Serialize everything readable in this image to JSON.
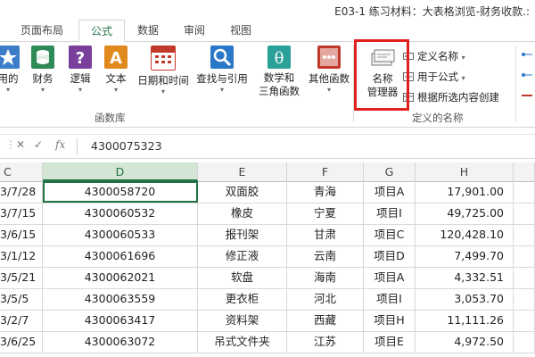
{
  "window": {
    "title": "E03-1 练习材料：大表格浏览-财务收款.:"
  },
  "tabs": [
    {
      "label": "页面布局"
    },
    {
      "label": "公式"
    },
    {
      "label": "数据"
    },
    {
      "label": "审阅"
    },
    {
      "label": "视图"
    }
  ],
  "ribbon": {
    "function_buttons": [
      {
        "label": "用的",
        "icon": "star-icon",
        "color": "#3b7dc8"
      },
      {
        "label": "财务",
        "icon": "coins-icon",
        "color": "#2e8b57"
      },
      {
        "label": "逻辑",
        "icon": "question-icon",
        "color": "#7a3e9d"
      },
      {
        "label": "文本",
        "icon": "text-a-icon",
        "color": "#e08a1e"
      },
      {
        "label": "日期和时间",
        "icon": "calendar-icon",
        "color": "#c0392b"
      },
      {
        "label": "查找与引用",
        "icon": "search-ref-icon",
        "color": "#2a78c8"
      },
      {
        "label_line1": "数学和",
        "label_line2": "三角函数",
        "icon": "theta-icon",
        "color": "#2aa198"
      },
      {
        "label": "其他函数",
        "icon": "more-functions-icon",
        "color": "#c0392b"
      }
    ],
    "function_group_label": "函数库",
    "name_manager": {
      "line1": "名称",
      "line2": "管理器",
      "icon": "name-manager-icon"
    },
    "define_name": {
      "label": "定义名称",
      "icon": "tag-icon"
    },
    "use_in_formula": {
      "label": "用于公式",
      "icon": "formula-icon"
    },
    "create_from_selection": {
      "label": "根据所选内容创建",
      "icon": "grid-create-icon"
    },
    "defined_names_group_label": "定义的名称"
  },
  "formula_bar": {
    "cancel_symbol": "✕",
    "enter_symbol": "✓",
    "fx_label": "fx",
    "value": "4300075323"
  },
  "column_headers": [
    "C",
    "D",
    "E",
    "F",
    "G",
    "H"
  ],
  "rows": [
    {
      "c": "3/7/28",
      "d": "4300058720",
      "e": "双面胶",
      "f": "青海",
      "g": "项目A",
      "h": "17,901.00"
    },
    {
      "c": "3/7/15",
      "d": "4300060532",
      "e": "橡皮",
      "f": "宁夏",
      "g": "项目I",
      "h": "49,725.00"
    },
    {
      "c": "3/6/15",
      "d": "4300060533",
      "e": "报刊架",
      "f": "甘肃",
      "g": "项目C",
      "h": "120,428.10"
    },
    {
      "c": "3/1/12",
      "d": "4300061696",
      "e": "修正液",
      "f": "云南",
      "g": "项目D",
      "h": "7,499.70"
    },
    {
      "c": "3/5/21",
      "d": "4300062021",
      "e": "软盘",
      "f": "海南",
      "g": "项目A",
      "h": "4,332.51"
    },
    {
      "c": "3/5/5",
      "d": "4300063559",
      "e": "更衣柜",
      "f": "河北",
      "g": "项目I",
      "h": "3,053.70"
    },
    {
      "c": "3/2/7",
      "d": "4300063417",
      "e": "资料架",
      "f": "西藏",
      "g": "项目H",
      "h": "11,111.26"
    },
    {
      "c": "3/6/25",
      "d": "4300063072",
      "e": "吊式文件夹",
      "f": "江苏",
      "g": "项目E",
      "h": "4,972.50"
    }
  ],
  "colors": {
    "accent": "#217346",
    "highlight": "#e01f1f"
  }
}
